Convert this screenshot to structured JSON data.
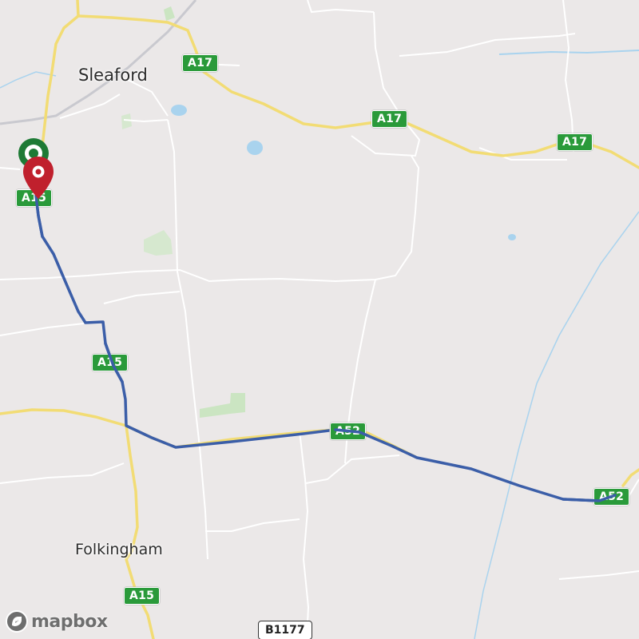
{
  "map": {
    "places": {
      "sleaford": "Sleaford",
      "folkingham": "Folkingham"
    },
    "roads": {
      "a17_1": "A17",
      "a17_2": "A17",
      "a17_3": "A17",
      "a15_1": "A15",
      "a15_2": "A15",
      "a15_3": "A15",
      "a52_1": "A52",
      "a52_2": "A52",
      "b1177": "B1177"
    },
    "markers": {
      "start_icon": "green-start-marker-icon",
      "end_icon": "red-pin-marker-icon"
    },
    "route_color": "#3b5ea8",
    "attribution": {
      "logo": "mapbox"
    }
  }
}
